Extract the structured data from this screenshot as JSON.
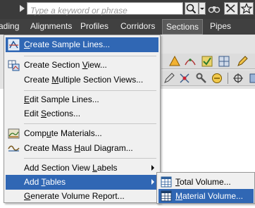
{
  "search": {
    "placeholder": "Type a keyword or phrase"
  },
  "tabs": [
    {
      "label": "ading"
    },
    {
      "label": "Alignments"
    },
    {
      "label": "Profiles"
    },
    {
      "label": "Corridors"
    },
    {
      "label": "Sections"
    },
    {
      "label": "Pipes"
    }
  ],
  "menu": {
    "items": [
      {
        "pre": "",
        "u": "C",
        "post": "reate Sample Lines..."
      },
      {
        "pre": "Create Section ",
        "u": "V",
        "post": "iew..."
      },
      {
        "pre": "Create ",
        "u": "M",
        "post": "ultiple Section Views..."
      },
      {
        "pre": "",
        "u": "E",
        "post": "dit Sample Lines..."
      },
      {
        "pre": "Edit ",
        "u": "S",
        "post": "ections..."
      },
      {
        "pre": "Comp",
        "u": "u",
        "post": "te Materials..."
      },
      {
        "pre": "Create Mass ",
        "u": "H",
        "post": "aul Diagram..."
      },
      {
        "pre": "Add Section View ",
        "u": "L",
        "post": "abels"
      },
      {
        "pre": "Add ",
        "u": "T",
        "post": "ables"
      },
      {
        "pre": "",
        "u": "G",
        "post": "enerate Volume Report..."
      }
    ]
  },
  "submenu": {
    "items": [
      {
        "pre": "",
        "u": "T",
        "post": "otal Volume..."
      },
      {
        "pre": "",
        "u": "M",
        "post": "aterial Volume..."
      }
    ]
  },
  "colors": {
    "highlight": "#3067b4",
    "menu_bg": "#f0f0f0",
    "topbar": "#3b3b3b"
  },
  "icons": [
    "play-icon",
    "search-icon",
    "binoculars-icon",
    "tools-icon",
    "star-icon",
    "help-icon",
    "sample-lines-icon",
    "section-view-icon",
    "compute-materials-icon",
    "mass-haul-icon",
    "table-icon"
  ]
}
